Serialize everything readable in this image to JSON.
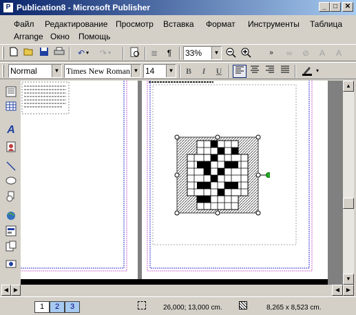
{
  "window": {
    "app_icon_glyph": "P",
    "title": "Publication8 - Microsoft Publisher",
    "minimize_glyph": "_",
    "maximize_glyph": "□",
    "close_glyph": "✕"
  },
  "menu": {
    "items": [
      "Файл",
      "Редактирование",
      "Просмотр",
      "Вставка",
      "Формат",
      "Инструменты",
      "Таблица",
      "Arrange",
      "Окно",
      "Помощь"
    ]
  },
  "standard_toolbar": {
    "zoom_value": "33%",
    "icons": [
      "new-icon",
      "open-icon",
      "save-icon",
      "print-icon",
      "cut-icon",
      "copy-icon",
      "paste-icon",
      "undo-icon",
      "redo-icon",
      "preview-icon",
      "columns-icon",
      "pilcrow-icon",
      "zoom-out-icon",
      "zoom-in-icon",
      "more-icon",
      "link-icon",
      "unlink-icon",
      "text-shape-icon",
      "text-shape-icon-2"
    ]
  },
  "format_toolbar": {
    "style_value": "Normal",
    "font_value": "Times New Roman",
    "size_value": "14",
    "bold": "B",
    "italic": "I",
    "underline": "U"
  },
  "left_tools": [
    "text-box-icon",
    "table-icon",
    "wordart-icon",
    "picture-icon",
    "line-icon",
    "oval-icon",
    "custom-shape-icon",
    "hotspot-icon",
    "form-control-icon",
    "html-code-icon",
    "design-gallery-icon"
  ],
  "status": {
    "pages": [
      "1",
      "2",
      "3"
    ],
    "active_page": "1",
    "position": "26,000; 13,000 cm.",
    "size": "8,265 x 8,523 cm."
  },
  "colors": {
    "title_start": "#0a246a",
    "title_end": "#a6caf0",
    "chrome": "#d4d0c8",
    "workspace": "#808080",
    "guide_blue": "#3333cc",
    "guide_pink": "#cc66cc",
    "handle_green": "#22aa22"
  }
}
